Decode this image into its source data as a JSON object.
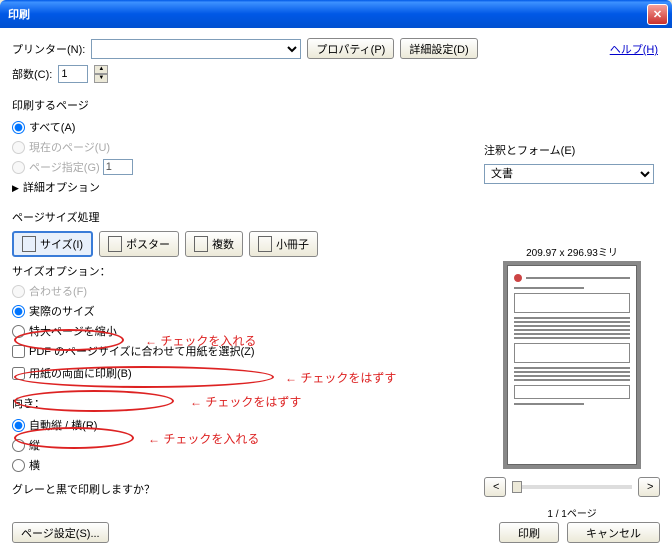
{
  "title": "印刷",
  "help": "ヘルプ(H)",
  "printer": {
    "label": "プリンター(N):",
    "value": "",
    "properties": "プロパティ(P)",
    "advanced": "詳細設定(D)"
  },
  "copies": {
    "label": "部数(C):",
    "value": "1"
  },
  "pages": {
    "title": "印刷するページ",
    "all": "すべて(A)",
    "current": "現在のページ(U)",
    "range": "ページ指定(G)",
    "range_value": "1",
    "more": "詳細オプション"
  },
  "sizing": {
    "title": "ページサイズ処理",
    "size_btn": "サイズ(I)",
    "poster": "ポスター",
    "multi": "複数",
    "booklet": "小冊子",
    "option_label": "サイズオプション：",
    "fit": "合わせる(F)",
    "actual": "実際のサイズ",
    "shrink": "特大ページを縮小",
    "choose_paper": "PDF のページサイズに合わせて用紙を選択(Z)",
    "duplex": "用紙の両面に印刷(B)"
  },
  "orient": {
    "title": "向き：",
    "auto": "自動縦 / 横(R)",
    "portrait": "縦",
    "landscape": "横"
  },
  "gray": "グレーと黒で印刷しますか？",
  "comments": {
    "title": "注釈とフォーム(E)",
    "value": "文書"
  },
  "preview": {
    "dims": "209.97 x 296.93ミリ",
    "page_of": "1 / 1ページ"
  },
  "nav": {
    "prev": "<",
    "next": ">"
  },
  "bottom": {
    "page_setup": "ページ設定(S)...",
    "print": "印刷",
    "cancel": "キャンセル"
  },
  "annotations": {
    "check_on1": "← チェックを入れる",
    "check_off1": "← チェックをはずす",
    "check_off2": "← チェックをはずす",
    "check_on2": "← チェックを入れる"
  }
}
